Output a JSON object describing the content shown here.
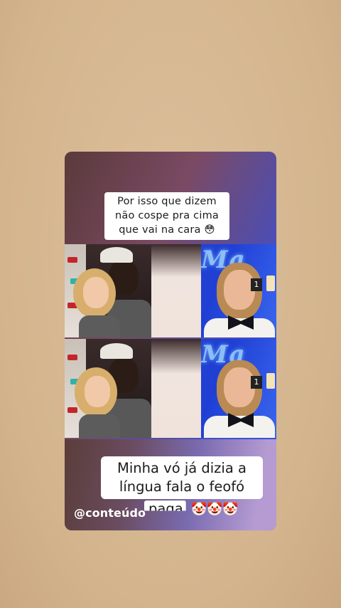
{
  "caption_top": {
    "line1": "Por isso que dizem",
    "line2": "não cospe pra cima",
    "line3": "que vai na cara 😳"
  },
  "caption_bottom": {
    "line1": "Minha vó já dizia a",
    "line2": "língua fala o feofó",
    "line3": "paga"
  },
  "handle": "@conteúdo",
  "emojis": [
    "🤡",
    "🤡",
    "🤡"
  ],
  "tv_sign": "1",
  "tv_neon": "Ma",
  "colors": {
    "background": "#d8b993",
    "card_accent": "#2a54e6",
    "caption_bg": "#ffffff"
  }
}
